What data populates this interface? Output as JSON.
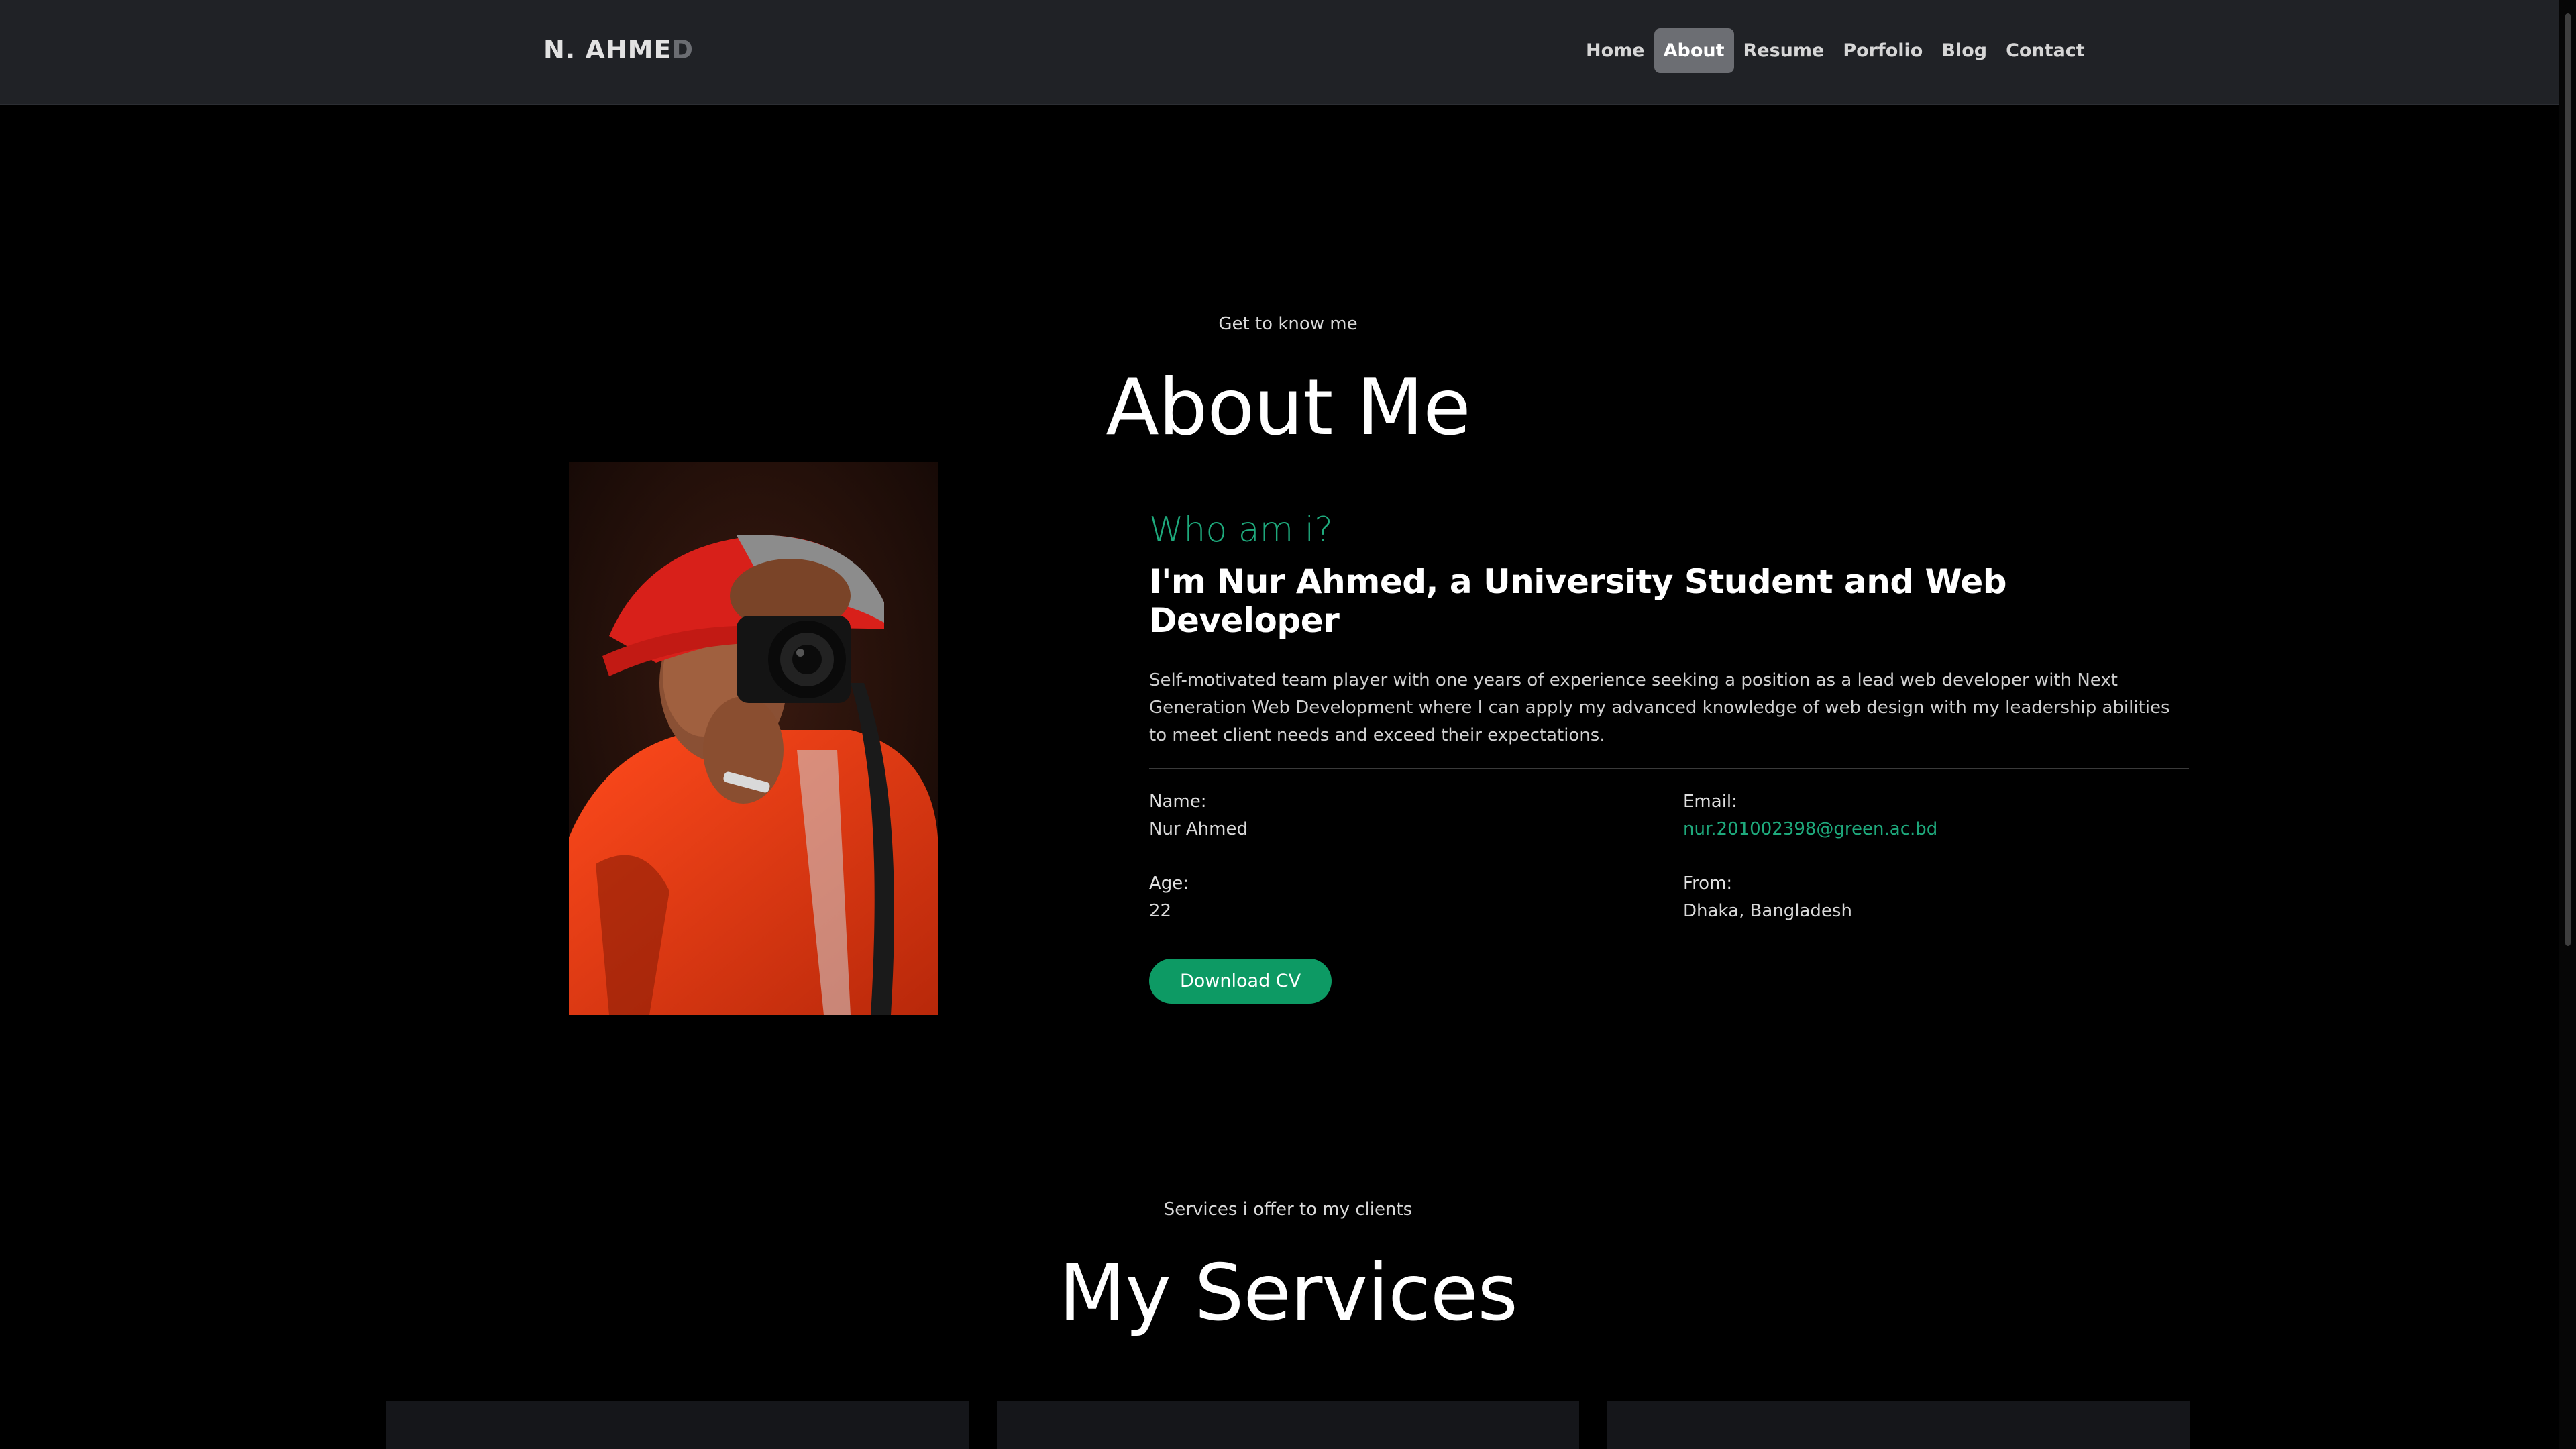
{
  "navbar": {
    "brand_main": "N. AHME",
    "brand_fade": "D",
    "items": [
      {
        "label": "Home",
        "active": false
      },
      {
        "label": "About",
        "active": true
      },
      {
        "label": "Resume",
        "active": false
      },
      {
        "label": "Porfolio",
        "active": false
      },
      {
        "label": "Blog",
        "active": false
      },
      {
        "label": "Contact",
        "active": false
      }
    ]
  },
  "about": {
    "eyebrow": "Get to know me",
    "title": "About Me",
    "photo_alt_icon": "portrait-photo",
    "who": "Who am i?",
    "headline": "I'm Nur Ahmed, a University Student and Web Developer",
    "bio": "Self-motivated team player with one years of experience seeking a position as a lead web developer with Next Generation Web Development where I can apply my advanced knowledge of web design with my leadership abilities to meet client needs and exceed their expectations.",
    "info": {
      "name_label": "Name:",
      "name_value": "Nur Ahmed",
      "email_label": "Email:",
      "email_value": "nur.201002398@green.ac.bd",
      "age_label": "Age:",
      "age_value": "22",
      "from_label": "From:",
      "from_value": "Dhaka, Bangladesh"
    },
    "cta_label": "Download CV"
  },
  "services": {
    "eyebrow": "Services i offer to my clients",
    "title": "My Services"
  },
  "colors": {
    "accent": "#1ea97c",
    "button": "#0d9a64",
    "navbar_bg": "#202226",
    "page_bg": "#000000"
  }
}
